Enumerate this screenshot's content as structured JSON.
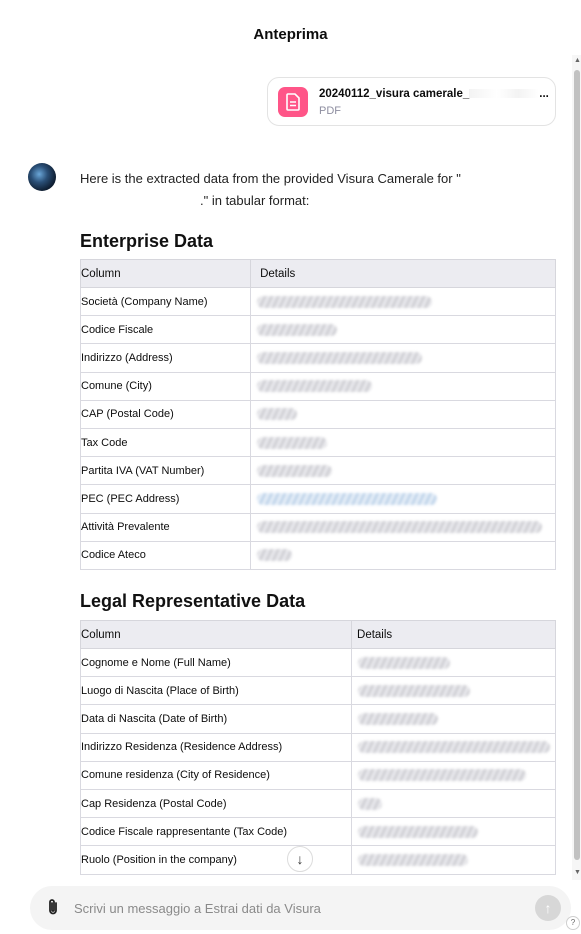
{
  "header": {
    "title": "Anteprima"
  },
  "attachment": {
    "name": "20240112_visura camerale_",
    "type": "PDF",
    "icon": "document-icon"
  },
  "message": {
    "intro_a": "Here is the extracted data from the provided Visura Camerale for \"",
    "intro_b": ".\" in tabular format:"
  },
  "enterprise": {
    "heading": "Enterprise Data",
    "col1": "Column",
    "col2": "Details",
    "rows": [
      "Società (Company Name)",
      "Codice Fiscale",
      "Indirizzo (Address)",
      "Comune (City)",
      "CAP (Postal Code)",
      "Tax Code",
      "Partita IVA (VAT Number)",
      "PEC (PEC Address)",
      "Attività Prevalente",
      "Codice Ateco"
    ]
  },
  "legal": {
    "heading": "Legal Representative Data",
    "col1": "Column",
    "col2": "Details",
    "rows": [
      "Cognome e Nome (Full Name)",
      "Luogo di Nascita (Place of Birth)",
      "Data di Nascita (Date of Birth)",
      "Indirizzo Residenza (Residence Address)",
      "Comune residenza (City of Residence)",
      "Cap Residenza (Postal Code)",
      "Codice Fiscale rappresentante (Tax Code)",
      "Ruolo (Position in the company)"
    ]
  },
  "composer": {
    "placeholder": "Scrivi un messaggio a Estrai dati da Visura"
  },
  "scroll_down_glyph": "↓",
  "send_glyph": "↑",
  "help_glyph": "?"
}
